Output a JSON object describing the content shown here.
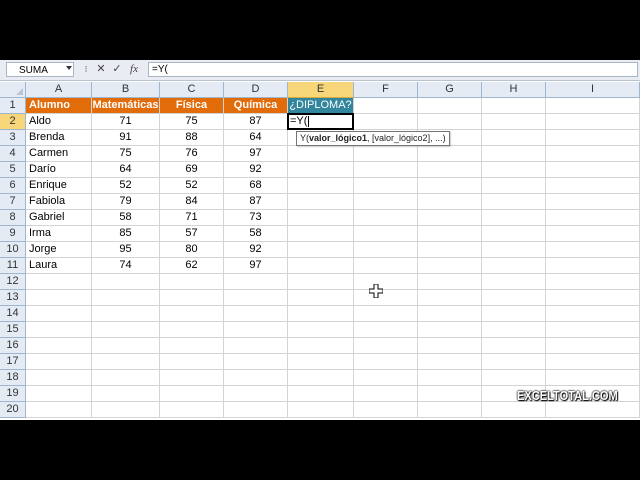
{
  "formula_bar": {
    "name_box": "SUMA",
    "cancel_symbol": "✕",
    "enter_symbol": "✓",
    "fx_symbol": "fx",
    "formula": "=Y("
  },
  "columns": [
    "A",
    "B",
    "C",
    "D",
    "E",
    "F",
    "G",
    "H",
    "I"
  ],
  "rows": [
    "1",
    "2",
    "3",
    "4",
    "5",
    "6",
    "7",
    "8",
    "9",
    "10",
    "11",
    "12",
    "13",
    "14",
    "15",
    "16",
    "17",
    "18",
    "19",
    "20"
  ],
  "header_row": {
    "alumno": "Alumno",
    "matematicas": "Matemáticas",
    "fisica": "Física",
    "quimica": "Química",
    "diploma": "¿DIPLOMA?"
  },
  "students": [
    {
      "name": "Aldo",
      "mat": "71",
      "fis": "75",
      "qui": "87"
    },
    {
      "name": "Brenda",
      "mat": "91",
      "fis": "88",
      "qui": "64"
    },
    {
      "name": "Carmen",
      "mat": "75",
      "fis": "76",
      "qui": "97"
    },
    {
      "name": "Darío",
      "mat": "64",
      "fis": "69",
      "qui": "92"
    },
    {
      "name": "Enrique",
      "mat": "52",
      "fis": "52",
      "qui": "68"
    },
    {
      "name": "Fabiola",
      "mat": "79",
      "fis": "84",
      "qui": "87"
    },
    {
      "name": "Gabriel",
      "mat": "58",
      "fis": "71",
      "qui": "73"
    },
    {
      "name": "Irma",
      "mat": "85",
      "fis": "57",
      "qui": "58"
    },
    {
      "name": "Jorge",
      "mat": "95",
      "fis": "80",
      "qui": "92"
    },
    {
      "name": "Laura",
      "mat": "74",
      "fis": "62",
      "qui": "97"
    }
  ],
  "active_cell": {
    "ref": "E2",
    "text": "=Y("
  },
  "tooltip": {
    "func": "Y(",
    "bold_arg": "valor_lógico1",
    "rest": ", [valor_lógico2], ...)"
  },
  "watermark": "EXCELTOTAL.COM",
  "colors": {
    "header_orange": "#e26b0a",
    "header_teal": "#31859c",
    "header_active": "#f7d67a"
  }
}
